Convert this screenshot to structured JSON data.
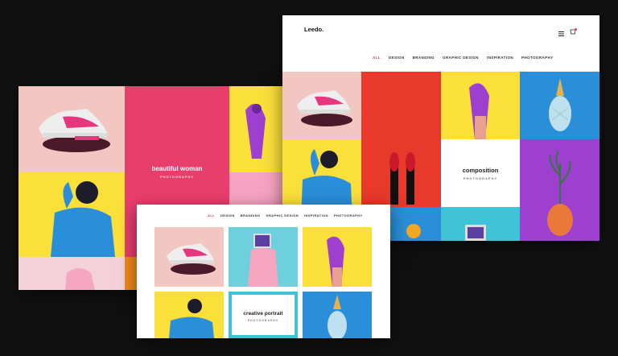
{
  "brand": "Leedo.",
  "nav": [
    "ALL",
    "DESIGN",
    "BRANDING",
    "GRAPHIC DESIGN",
    "INSPIRATION",
    "PHOTOGRAPHY"
  ],
  "back_panel": {
    "title": "beautiful woman",
    "subtitle": "PHOTOGRAPHY"
  },
  "right_panel": {
    "title": "composition",
    "subtitle": "PHOTOGRAPHY"
  },
  "front_panel": {
    "title": "creative portrait",
    "subtitle": "PHOTOGRAPHY"
  },
  "colors": {
    "accent": "#e8336d",
    "pink": "#e83e6c",
    "yellow": "#fbe03a",
    "blue": "#2a8fd8",
    "purple": "#9d3fcf",
    "red": "#e8392a"
  },
  "icons": [
    "menu-icon",
    "cart-icon"
  ]
}
